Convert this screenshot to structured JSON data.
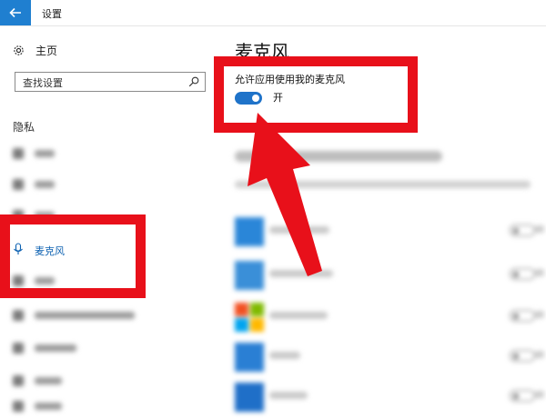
{
  "window": {
    "title": "设置"
  },
  "sidebar": {
    "home_label": "主页",
    "search_placeholder": "查找设置",
    "section_title": "隐私",
    "active_item_label": "麦克风"
  },
  "main": {
    "page_title": "麦克风",
    "allow_label": "允许应用使用我的麦克风",
    "toggle_state": "开",
    "toggle_on": true
  },
  "colors": {
    "accent": "#1f7fd0",
    "highlight": "#e8101a"
  }
}
